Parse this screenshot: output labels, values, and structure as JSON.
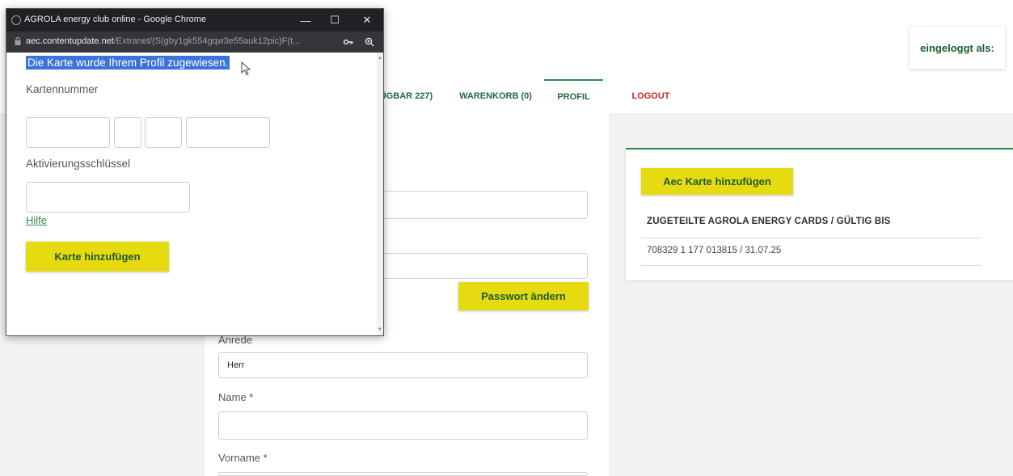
{
  "site": {
    "login_label": "eingeloggt als:",
    "nav": {
      "verfugbar": "ÜGBAR 227)",
      "warenkorb": "WARENKORB (0)",
      "profil": "PROFIL",
      "logout": "LOGOUT"
    },
    "form": {
      "password_button": "Passwort ändern",
      "anrede_label": "Anrede",
      "anrede_value": "Herr",
      "name_label": "Name *",
      "name_value": "",
      "vorname_label": "Vorname *"
    },
    "cards": {
      "add_button": "Aec Karte hinzufügen",
      "heading": "ZUGETEILTE AGROLA ENERGY CARDS / GÜLTIG BIS",
      "rows": [
        "708329 1 177 013815 / 31.07.25"
      ]
    }
  },
  "popup": {
    "window_title": "AGROLA energy club online - Google Chrome",
    "url_host": "aec.contentupdate.net",
    "url_path": "/Extranet/(S(gby1gk554gqw3e55auk12pic)F(t...",
    "message": "Die Karte wurde Ihrem Profil zugewiesen.",
    "kartennummer_label": "Kartennummer",
    "aktivierung_label": "Aktivierungsschlüssel",
    "help_link": "Hilfe",
    "submit_button": "Karte hinzufügen"
  },
  "colors": {
    "accent_green": "#2c8a4f",
    "button_yellow": "#e6da10",
    "logout_red": "#c62828",
    "selection_blue": "#3b73d8"
  }
}
